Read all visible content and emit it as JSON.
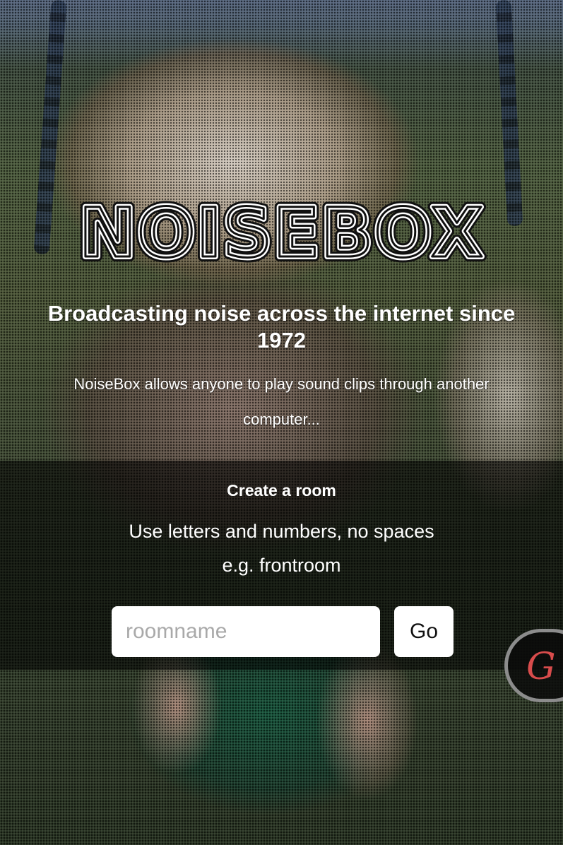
{
  "brand": {
    "logo_text": "NOISEBOX"
  },
  "hero": {
    "tagline": "Broadcasting noise across the internet since 1972",
    "intro": "NoiseBox allows anyone to play sound clips through another computer..."
  },
  "create_room": {
    "heading": "Create a room",
    "hint_line1": "Use letters and numbers, no spaces",
    "hint_line2": "e.g. frontroom",
    "input_placeholder": "roomname",
    "input_value": "",
    "go_label": "Go"
  },
  "floating_badge": {
    "letter": "G",
    "color": "#d84c4c"
  },
  "colors": {
    "panel_overlay": "rgba(0,0,0,0.55)",
    "text": "#ffffff"
  }
}
